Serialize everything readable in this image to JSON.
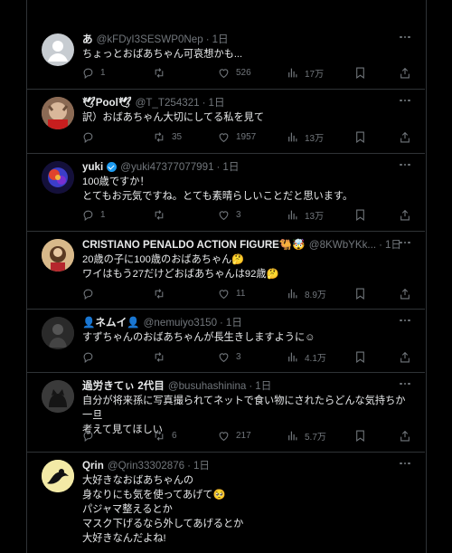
{
  "tweets": [
    {
      "name": "あ",
      "handle": "@kFDyI3SESWP0Nep",
      "time": "1日",
      "lines": [
        "ちょっとおばあちゃん可哀想かも..."
      ],
      "replies": "1",
      "retweets": "",
      "likes": "526",
      "views": "17万"
    },
    {
      "name": "🕊Pool🕊",
      "handle": "@T_T254321",
      "time": "1日",
      "lines": [
        "訳）おばあちゃん大切にしてる私を見て"
      ],
      "replies": "",
      "retweets": "35",
      "likes": "1957",
      "views": "13万"
    },
    {
      "name": "yuki",
      "handle": "@yuki47377077991",
      "time": "1日",
      "lines": [
        "100歳ですか！",
        "とてもお元気ですね。とても素晴らしいことだと思います。"
      ],
      "replies": "1",
      "retweets": "",
      "likes": "3",
      "views": "13万"
    },
    {
      "name": "CRISTIANO PENALDO ACTION FIGURE🐫🤯",
      "handle": "@8KWbYKk...",
      "time": "1日",
      "lines": [
        "20歳の子に100歳のおばあちゃん🤔",
        "ワイはもう27だけどおばあちゃんは92歳🤔"
      ],
      "replies": "",
      "retweets": "",
      "likes": "11",
      "views": "8.9万"
    },
    {
      "name": "👤ネムイ👤",
      "handle": "@nemuiyo3150",
      "time": "1日",
      "lines": [
        "すずちゃんのおばあちゃんが長生きしますように☺"
      ],
      "replies": "",
      "retweets": "",
      "likes": "3",
      "views": "4.1万"
    },
    {
      "name": "過労きてぃ 2代目",
      "handle": "@busuhashinina",
      "time": "1日",
      "lines": [
        "自分が将来孫に写真撮られてネットで食い物にされたらどんな気持ちか一旦",
        "考えて見てほしい"
      ],
      "replies": "",
      "retweets": "6",
      "likes": "217",
      "views": "5.7万"
    },
    {
      "name": "Qrin",
      "handle": "@Qrin33302876",
      "time": "1日",
      "lines": [
        "大好きなおばあちゃんの",
        "身なりにも気を使ってあげて🥺",
        "パジャマ整えるとか",
        "マスク下げるなら外してあげるとか",
        "大好きなんだよね!"
      ],
      "replies": "",
      "retweets": "",
      "likes": "",
      "views": ""
    }
  ],
  "colors": {
    "background": "#000000",
    "text": "#e7e9ea",
    "secondary": "#71767b",
    "border": "#2f3336",
    "verified": "#1d9bf0"
  },
  "icons": [
    "reply-icon",
    "retweet-icon",
    "like-icon",
    "views-icon",
    "bookmark-icon",
    "share-icon",
    "more-icon"
  ]
}
